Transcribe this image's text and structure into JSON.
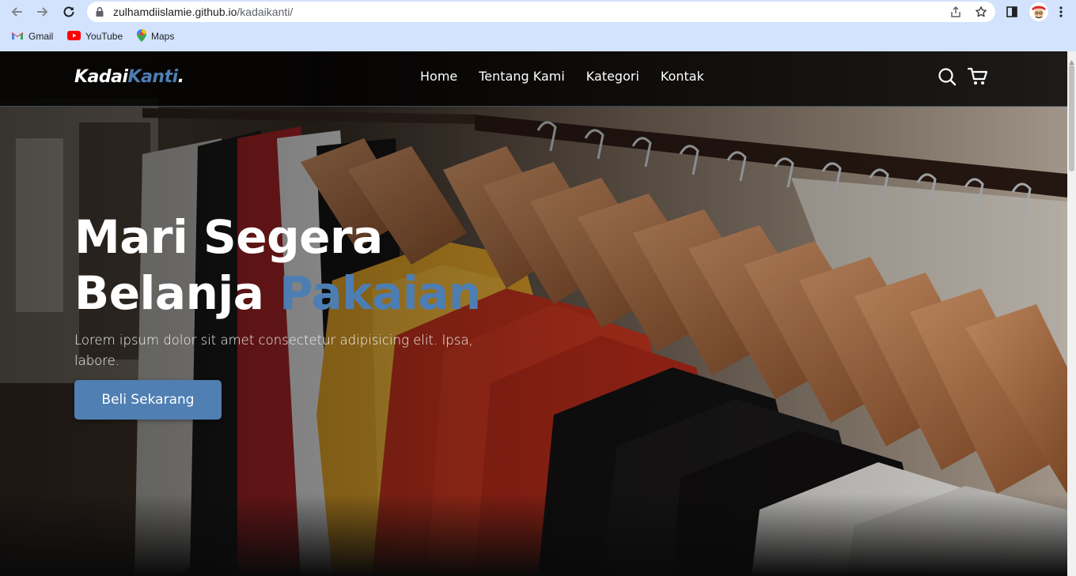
{
  "browser": {
    "url_host": "zulhamdiislamie.github.io",
    "url_path": "/kadaikanti/",
    "bookmarks": [
      {
        "label": "Gmail",
        "icon": "gmail-icon"
      },
      {
        "label": "YouTube",
        "icon": "youtube-icon"
      },
      {
        "label": "Maps",
        "icon": "maps-icon"
      }
    ]
  },
  "site": {
    "logo_main": "Kadai",
    "logo_accent": "Kanti",
    "logo_dot": ".",
    "menu": [
      "Home",
      "Tentang Kami",
      "Kategori",
      "Kontak"
    ]
  },
  "hero": {
    "title_line1": "Mari Segera",
    "title_line2_plain": "Belanja ",
    "title_line2_accent": "Pakaian",
    "description": "Lorem ipsum dolor sit amet consectetur adipisicing elit. Ipsa, labore.",
    "cta_label": "Beli Sekarang"
  },
  "colors": {
    "accent": "#4c7eb3",
    "chrome": "#d3e3fd",
    "navbar": "#000000"
  }
}
